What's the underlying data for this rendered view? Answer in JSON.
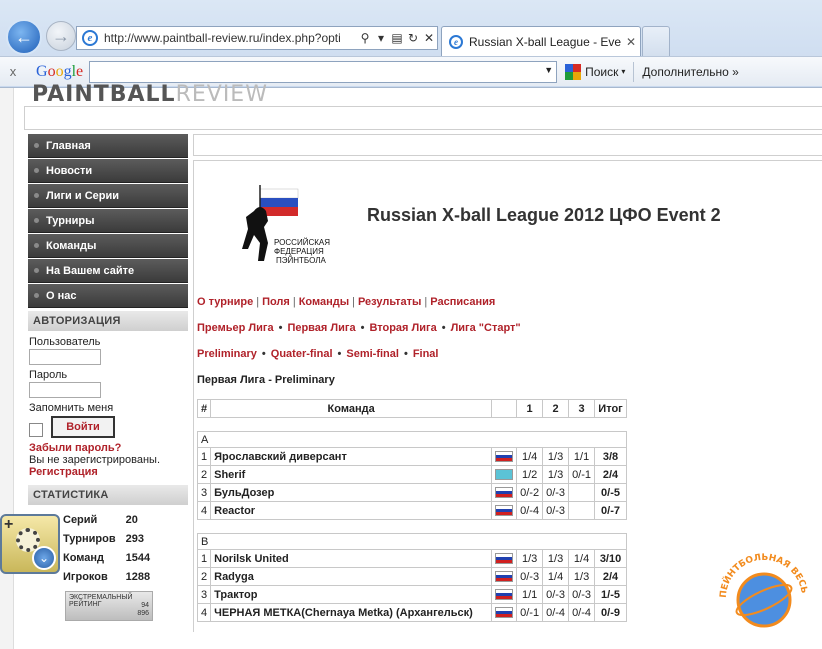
{
  "browser": {
    "url": "http://www.paintball-review.ru/index.php?opti",
    "tab_title": "Russian X-ball League - Eve...",
    "google_logo": "Google",
    "search_button": "Поиск",
    "more_button": "Дополнительно »"
  },
  "site": {
    "logo_main": "PAINTBALL",
    "logo_light": "REVIEW"
  },
  "sidebar": {
    "menu": [
      {
        "label": "Главная"
      },
      {
        "label": "Новости"
      },
      {
        "label": "Лиги и Серии"
      },
      {
        "label": "Турниры"
      },
      {
        "label": "Команды"
      },
      {
        "label": "На Вашем сайте"
      },
      {
        "label": "О нас"
      }
    ],
    "auth": {
      "heading": "АВТОРИЗАЦИЯ",
      "user_label": "Пользователь",
      "password_label": "Пароль",
      "remember_label": "Запомнить меня",
      "login_button": "Войти",
      "forgot": "Забыли пароль?",
      "not_registered": "Вы не зарегистрированы.",
      "register": "Регистрация"
    },
    "stats": {
      "heading": "СТАТИСТИКА",
      "rows": [
        {
          "label": "Серий",
          "value": "20"
        },
        {
          "label": "Турниров",
          "value": "293"
        },
        {
          "label": "Команд",
          "value": "1544"
        },
        {
          "label": "Игроков",
          "value": "1288"
        }
      ]
    },
    "rating_badge": {
      "title_line1": "ЭКСТРЕМАЛЬНЫЙ",
      "title_line2": "РЕЙТИНГ",
      "n1": "94",
      "n2": "896"
    }
  },
  "event": {
    "emblem_text": [
      "РОССИЙСКАЯ",
      "ФЕДЕРАЦИЯ",
      "ПЭЙНТБОЛА"
    ],
    "title": "Russian X-ball League  2012 ЦФО  Event 2",
    "nav1": [
      "О турнире",
      "Поля",
      "Команды",
      "Результаты",
      "Расписания"
    ],
    "nav2": [
      "Премьер Лига",
      "Первая Лига",
      "Вторая Лига",
      "Лига \"Старт\""
    ],
    "nav3": [
      "Preliminary",
      "Quater-final",
      "Semi-final",
      "Final"
    ],
    "subtitle": "Первая Лига - Preliminary"
  },
  "results": {
    "headers": {
      "num": "#",
      "team": "Команда",
      "g1": "1",
      "g2": "2",
      "g3": "3",
      "total": "Итог"
    },
    "groups": [
      {
        "name": "A",
        "rows": [
          {
            "n": "1",
            "team": "Ярославский диверсант",
            "flag": "ru",
            "g1": "1/4",
            "g2": "1/3",
            "g3": "1/1",
            "total": "3/8"
          },
          {
            "n": "2",
            "team": "Sherif",
            "flag": "kz",
            "g1": "1/2",
            "g2": "1/3",
            "g3": "0/-1",
            "total": "2/4"
          },
          {
            "n": "3",
            "team": "БульДозер",
            "flag": "ru",
            "g1": "0/-2",
            "g2": "0/-3",
            "g3": "",
            "total": "0/-5"
          },
          {
            "n": "4",
            "team": "Reactor",
            "flag": "ru",
            "g1": "0/-4",
            "g2": "0/-3",
            "g3": "",
            "total": "0/-7"
          }
        ]
      },
      {
        "name": "B",
        "rows": [
          {
            "n": "1",
            "team": "Norilsk United",
            "flag": "ru",
            "g1": "1/3",
            "g2": "1/3",
            "g3": "1/4",
            "total": "3/10"
          },
          {
            "n": "2",
            "team": "Radyga",
            "flag": "ru",
            "g1": "0/-3",
            "g2": "1/4",
            "g3": "1/3",
            "total": "2/4"
          },
          {
            "n": "3",
            "team": "Трактор",
            "flag": "ru",
            "g1": "1/1",
            "g2": "0/-3",
            "g3": "0/-3",
            "total": "1/-5"
          },
          {
            "n": "4",
            "team": "ЧЕРНАЯ МЕТКА(Chernaya Metka) (Архангельск)",
            "flag": "ru",
            "g1": "0/-1",
            "g2": "0/-4",
            "g3": "0/-4",
            "total": "0/-9"
          }
        ]
      }
    ]
  },
  "stamp_text": "ПЕЙНТБОЛЬНАЯ ВЕСЬ"
}
